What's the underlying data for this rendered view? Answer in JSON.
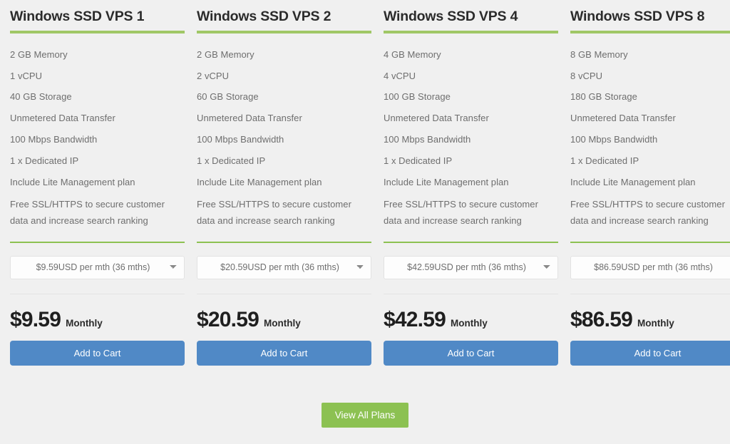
{
  "plans": [
    {
      "title": "Windows SSD VPS 1",
      "features": [
        "2 GB Memory",
        "1 vCPU",
        "40 GB Storage",
        "Unmetered Data Transfer",
        "100 Mbps Bandwidth",
        "1 x Dedicated IP",
        "Include Lite Management plan",
        "Free SSL/HTTPS to secure customer data and increase search ranking"
      ],
      "term_selected": "$9.59USD per mth (36 mths)",
      "price": "$9.59",
      "period": "Monthly",
      "cart_label": "Add to Cart"
    },
    {
      "title": "Windows SSD VPS 2",
      "features": [
        "2 GB Memory",
        "2 vCPU",
        "60 GB Storage",
        "Unmetered Data Transfer",
        "100 Mbps Bandwidth",
        "1 x Dedicated IP",
        "Include Lite Management plan",
        "Free SSL/HTTPS to secure customer data and increase search ranking"
      ],
      "term_selected": "$20.59USD per mth (36 mths)",
      "price": "$20.59",
      "period": "Monthly",
      "cart_label": "Add to Cart"
    },
    {
      "title": "Windows SSD VPS 4",
      "features": [
        "4 GB Memory",
        "4 vCPU",
        "100 GB Storage",
        "Unmetered Data Transfer",
        "100 Mbps Bandwidth",
        "1 x Dedicated IP",
        "Include Lite Management plan",
        "Free SSL/HTTPS to secure customer data and increase search ranking"
      ],
      "term_selected": "$42.59USD per mth (36 mths)",
      "price": "$42.59",
      "period": "Monthly",
      "cart_label": "Add to Cart"
    },
    {
      "title": "Windows SSD VPS 8",
      "features": [
        "8 GB Memory",
        "8 vCPU",
        "180 GB Storage",
        "Unmetered Data Transfer",
        "100 Mbps Bandwidth",
        "1 x Dedicated IP",
        "Include Lite Management plan",
        "Free SSL/HTTPS to secure customer data and increase search ranking"
      ],
      "term_selected": "$86.59USD per mth (36 mths)",
      "price": "$86.59",
      "period": "Monthly",
      "cart_label": "Add to Cart"
    }
  ],
  "footer": {
    "view_all_label": "View All Plans"
  },
  "colors": {
    "accent_green": "#8cc152",
    "title_rule_green": "#a0c766",
    "button_blue": "#5089c6",
    "page_background": "#f0f0f0",
    "feature_text": "#6e6e6e",
    "heading_text": "#2b2b2b"
  }
}
